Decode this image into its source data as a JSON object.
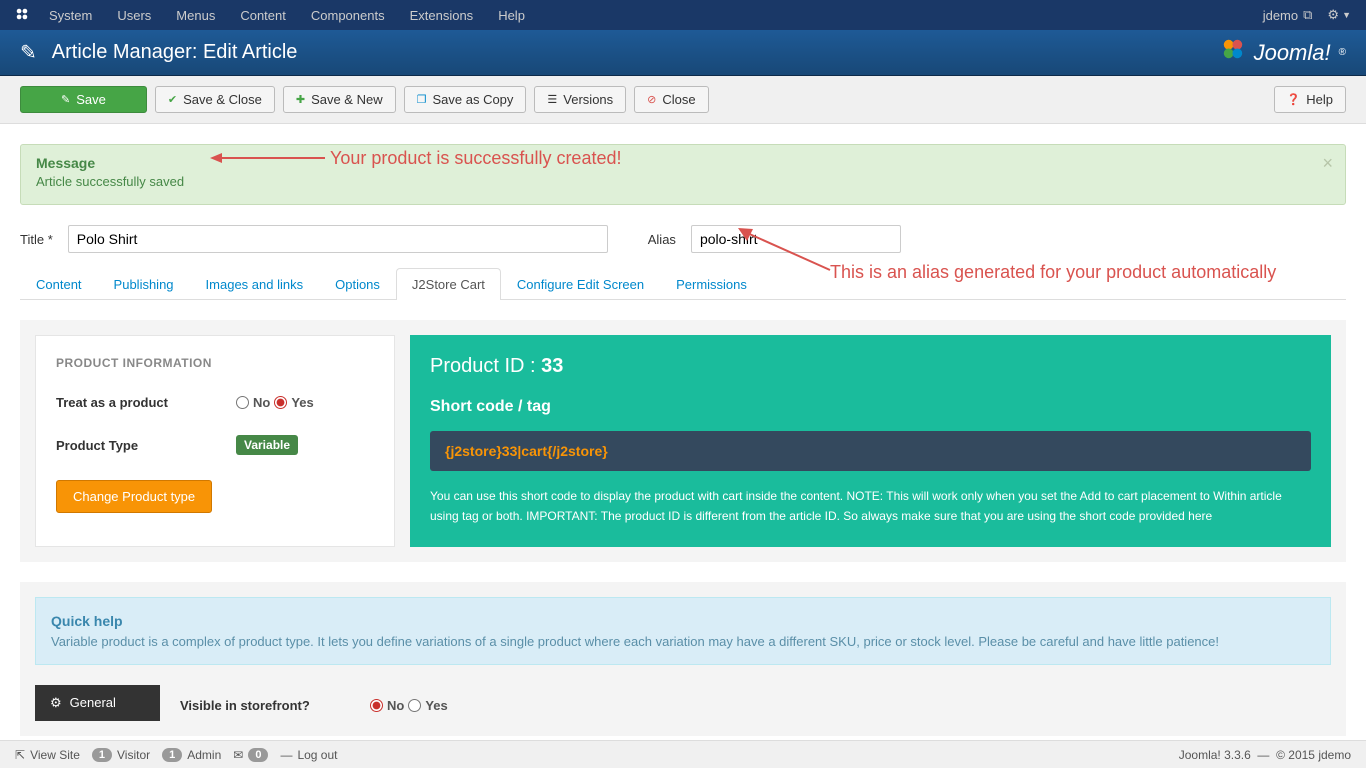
{
  "navbar": {
    "items": [
      "System",
      "Users",
      "Menus",
      "Content",
      "Components",
      "Extensions",
      "Help"
    ],
    "user": "jdemo"
  },
  "header": {
    "title": "Article Manager: Edit Article",
    "logo": "Joomla!"
  },
  "toolbar": {
    "save": "Save",
    "save_close": "Save & Close",
    "save_new": "Save & New",
    "save_copy": "Save as Copy",
    "versions": "Versions",
    "close": "Close",
    "help": "Help"
  },
  "message": {
    "heading": "Message",
    "body": "Article successfully saved"
  },
  "annotations": {
    "created": "Your product is successfully created!",
    "alias": "This is an alias generated for your product automatically"
  },
  "form": {
    "title_label": "Title *",
    "title_value": "Polo Shirt",
    "alias_label": "Alias",
    "alias_value": "polo-shirt"
  },
  "tabs": [
    "Content",
    "Publishing",
    "Images and links",
    "Options",
    "J2Store Cart",
    "Configure Edit Screen",
    "Permissions"
  ],
  "active_tab": "J2Store Cart",
  "product_info": {
    "heading": "PRODUCT INFORMATION",
    "treat_label": "Treat as a product",
    "no": "No",
    "yes": "Yes",
    "type_label": "Product Type",
    "type_value": "Variable",
    "change_btn": "Change Product type"
  },
  "product_panel": {
    "id_label": "Product ID :",
    "id_value": "33",
    "shortcode_label": "Short code / tag",
    "shortcode": "{j2store}33|cart{/j2store}",
    "desc": "You can use this short code to display the product with cart inside the content. NOTE: This will work only when you set the Add to cart placement to Within article using tag or both. IMPORTANT: The product ID is different from the article ID. So always make sure that you are using the short code provided here"
  },
  "quickhelp": {
    "heading": "Quick help",
    "body": "Variable product is a complex of product type. It lets you define variations of a single product where each variation may have a different SKU, price or stock level. Please be careful and have little patience!"
  },
  "general": {
    "tab": "General",
    "visible_label": "Visible in storefront?",
    "no": "No",
    "yes": "Yes"
  },
  "statusbar": {
    "view_site": "View Site",
    "visitor_count": "1",
    "visitor": "Visitor",
    "admin_count": "1",
    "admin": "Admin",
    "mail_count": "0",
    "logout": "Log out",
    "version": "Joomla! 3.3.6",
    "copyright": "© 2015 jdemo"
  }
}
